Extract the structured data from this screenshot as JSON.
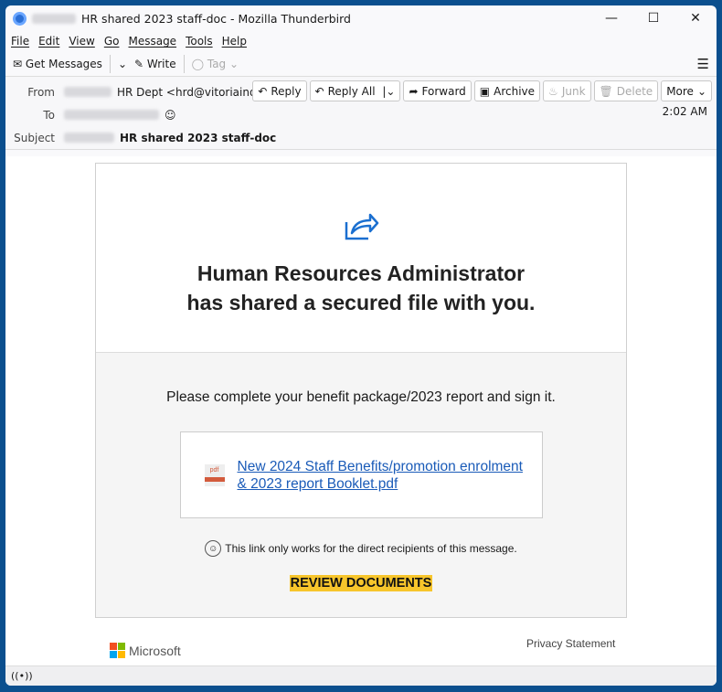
{
  "window": {
    "title": "HR shared 2023 staff-doc - Mozilla Thunderbird"
  },
  "menu": [
    "File",
    "Edit",
    "View",
    "Go",
    "Message",
    "Tools",
    "Help"
  ],
  "toolbar": {
    "get_messages": "Get Messages",
    "write": "Write",
    "tag": "Tag"
  },
  "header": {
    "from_label": "From",
    "from_value": "HR Dept <hrd@vitoriaind-br.com>",
    "to_label": "To",
    "subject_label": "Subject",
    "subject_value": "HR shared 2023 staff-doc",
    "time": "2:02 AM",
    "buttons": {
      "reply": "Reply",
      "reply_all": "Reply All",
      "forward": "Forward",
      "archive": "Archive",
      "junk": "Junk",
      "delete": "Delete",
      "more": "More"
    }
  },
  "email": {
    "heading1": "Human Resources Administrator",
    "heading2": "has shared a secured file with you.",
    "message": "Please complete your benefit package/2023 report and sign it.",
    "attachment_line1": "New 2024 Staff Benefits/promotion enrolment",
    "attachment_line2": "& 2023 report Booklet.pdf",
    "attachment_icon_label": "pdf",
    "note": "This link only works for the direct recipients of this message.",
    "cta": "REVIEW DOCUMENTS",
    "brand": "Microsoft",
    "privacy": "Privacy Statement"
  },
  "colors": {
    "accent": "#f7c52b",
    "link": "#1a5bb8",
    "frame": "#0b4f8e"
  }
}
